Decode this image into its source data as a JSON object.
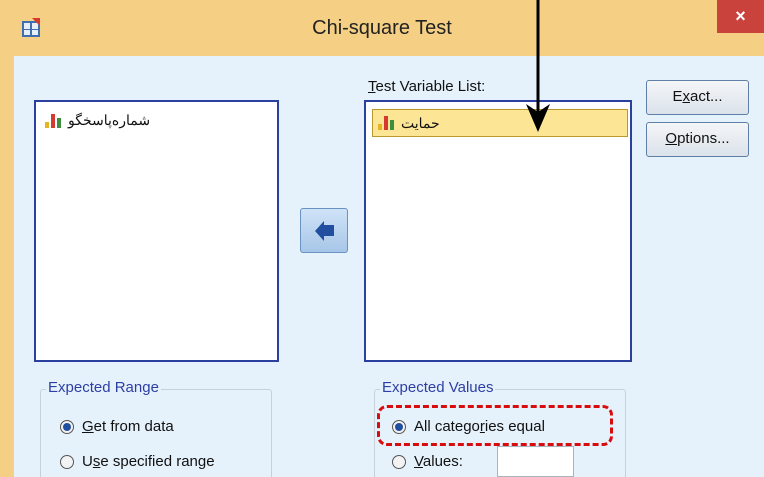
{
  "window": {
    "title": "Chi-square Test",
    "close_glyph": "×"
  },
  "source_list": {
    "items": [
      {
        "label": "شماره‌پاسخگو",
        "icon": "nominal-variable-icon"
      }
    ]
  },
  "test_variable_list": {
    "label_prefix": "T",
    "label_rest": "est Variable List:",
    "items": [
      {
        "label": "حمایت",
        "icon": "nominal-variable-icon",
        "selected": true
      }
    ]
  },
  "buttons": {
    "exact_pre": "E",
    "exact_u": "x",
    "exact_post": "act...",
    "options_pre": "",
    "options_u": "O",
    "options_post": "ptions..."
  },
  "expected_range": {
    "legend": "Expected Range",
    "get_from_data": {
      "pre": "",
      "u": "G",
      "post": "et from data",
      "checked": true
    },
    "use_specified": {
      "pre": "U",
      "u": "s",
      "post": "e specified range",
      "checked": false
    }
  },
  "expected_values": {
    "legend": "Expected Values",
    "all_equal": {
      "pre": "All catego",
      "u": "r",
      "post": "ies equal",
      "checked": true
    },
    "values": {
      "pre": "",
      "u": "V",
      "post": "alues:",
      "checked": false,
      "value": ""
    }
  },
  "colors": {
    "accent": "#d80c0c",
    "titlebar": "#f5cf84",
    "client": "#e6f2fb",
    "list_border": "#2a3f9e"
  }
}
